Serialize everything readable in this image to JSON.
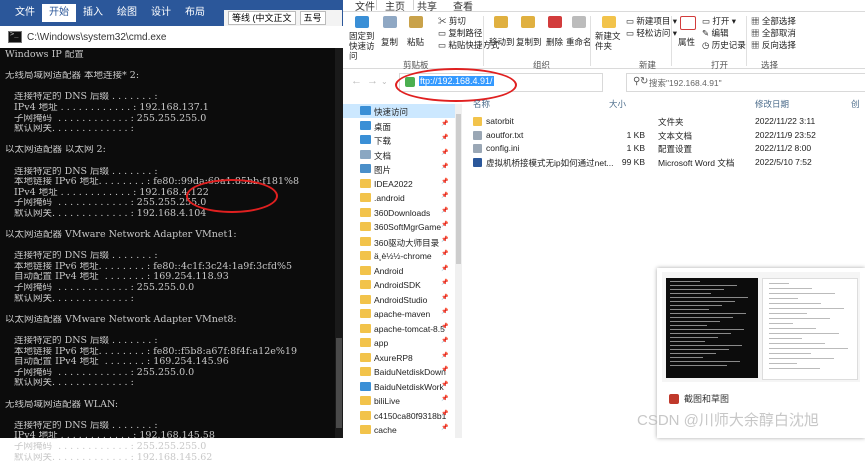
{
  "word": {
    "tabs": [
      "文件",
      "开始",
      "插入",
      "绘图",
      "设计",
      "布局"
    ],
    "font_name": "等线 (中文正文",
    "font_size": "五号"
  },
  "cmd": {
    "title": "C:\\Windows\\system32\\cmd.exe",
    "lines": [
      "Windows IP 配置",
      "",
      "无线局域网适配器 本地连接* 2:",
      "",
      "   连接特定的 DNS 后缀 . . . . . . . :",
      "   IPv4 地址 . . . . . . . . . . . . : 192.168.137.1",
      "   子网掩码  . . . . . . . . . . . . : 255.255.255.0",
      "   默认网关. . . . . . . . . . . . . :",
      "",
      "以太网适配器 以太网 2:",
      "",
      "   连接特定的 DNS 后缀 . . . . . . . :",
      "   本地链接 IPv6 地址. . . . . . . . : fe80::99da:69a1:85bb:f181%8",
      "   IPv4 地址 . . . . . . . . . . . . : 192.168.4.122",
      "   子网掩码  . . . . . . . . . . . . : 255.255.255.0",
      "   默认网关. . . . . . . . . . . . . : 192.168.4.104",
      "",
      "以太网适配器 VMware Network Adapter VMnet1:",
      "",
      "   连接特定的 DNS 后缀 . . . . . . . :",
      "   本地链接 IPv6 地址. . . . . . . . : fe80::4c1f:3c24:1a9f:3cfd%5",
      "   自动配置 IPv4 地址  . . . . . . . : 169.254.118.93",
      "   子网掩码  . . . . . . . . . . . . : 255.255.0.0",
      "   默认网关. . . . . . . . . . . . . :",
      "",
      "以太网适配器 VMware Network Adapter VMnet8:",
      "",
      "   连接特定的 DNS 后缀 . . . . . . . :",
      "   本地链接 IPv6 地址. . . . . . . . : fe80::f5b8:a67f:8f4f:a12e%19",
      "   自动配置 IPv4 地址  . . . . . . . : 169.254.145.96",
      "   子网掩码  . . . . . . . . . . . . : 255.255.0.0",
      "   默认网关. . . . . . . . . . . . . :",
      "",
      "无线局域网适配器 WLAN:",
      "",
      "   连接特定的 DNS 后缀 . . . . . . . :",
      "   IPv4 地址 . . . . . . . . . . . . : 192.168.145.58",
      "   子网掩码  . . . . . . . . . . . . : 255.255.255.0",
      "   默认网关. . . . . . . . . . . . . : 192.168.145.62"
    ]
  },
  "explorer": {
    "ribbon_tabs": [
      "文件",
      "主页",
      "共享",
      "查看"
    ],
    "ribbon": {
      "pin": "固定到快速访问",
      "copy": "复制",
      "paste": "粘贴",
      "cut": "剪切",
      "copy_path": "复制路径",
      "paste_shortcut": "粘贴快捷方式",
      "move_to": "移动到",
      "copy_to": "复制到",
      "delete": "删除",
      "rename": "重命名",
      "new_folder": "新建文件夹",
      "new_item": "新建项目",
      "easy_access": "轻松访问",
      "properties": "属性",
      "open": "打开",
      "edit": "编辑",
      "history": "历史记录",
      "select_all": "全部选择",
      "select_none": "全部取消",
      "invert": "反向选择",
      "groups": [
        "剪贴板",
        "组织",
        "新建",
        "打开",
        "选择"
      ]
    },
    "address": "ftp://192.168.4.91/",
    "search_placeholder": "搜索\"192.168.4.91\"",
    "columns": [
      "名称",
      "大小",
      "修改日期",
      "类型"
    ],
    "columns_extra": "创",
    "nav": [
      {
        "label": "快速访问",
        "icon": "star-icon",
        "color": "#3a8fd6",
        "selected": true,
        "pin": false
      },
      {
        "label": "桌面",
        "icon": "desktop-icon",
        "color": "#3a8fd6",
        "pin": true
      },
      {
        "label": "下载",
        "icon": "download-icon",
        "color": "#3a8fd6",
        "pin": true
      },
      {
        "label": "文档",
        "icon": "document-icon",
        "color": "#8aa7c2",
        "pin": true
      },
      {
        "label": "图片",
        "icon": "picture-icon",
        "color": "#4a8fc9",
        "pin": true
      },
      {
        "label": "IDEA2022",
        "icon": "folder-icon",
        "color": "#f2c34b",
        "pin": true
      },
      {
        "label": ".android",
        "icon": "folder-icon",
        "color": "#f2c34b",
        "pin": true
      },
      {
        "label": "360Downloads",
        "icon": "folder-icon",
        "color": "#f2c34b",
        "pin": true
      },
      {
        "label": "360SoftMgrGame",
        "icon": "folder-icon",
        "color": "#f2c34b",
        "pin": true
      },
      {
        "label": "360驱动大师目录",
        "icon": "folder-icon",
        "color": "#f2c34b",
        "pin": true
      },
      {
        "label": "ä¸è½½-chrome",
        "icon": "folder-icon",
        "color": "#f2c34b",
        "pin": true
      },
      {
        "label": "Android",
        "icon": "folder-icon",
        "color": "#f2c34b",
        "pin": true
      },
      {
        "label": "AndroidSDK",
        "icon": "folder-icon",
        "color": "#f2c34b",
        "pin": true
      },
      {
        "label": "AndroidStudio",
        "icon": "folder-icon",
        "color": "#f2c34b",
        "pin": true
      },
      {
        "label": "apache-maven",
        "icon": "folder-icon",
        "color": "#f2c34b",
        "pin": true
      },
      {
        "label": "apache-tomcat-8.5",
        "icon": "folder-icon",
        "color": "#f2c34b",
        "pin": true
      },
      {
        "label": "app",
        "icon": "folder-icon",
        "color": "#f2c34b",
        "pin": true
      },
      {
        "label": "AxureRP8",
        "icon": "folder-icon",
        "color": "#f2c34b",
        "pin": true
      },
      {
        "label": "BaiduNetdiskDown",
        "icon": "folder-icon",
        "color": "#f2c34b",
        "pin": true
      },
      {
        "label": "BaiduNetdiskWork",
        "icon": "folder-icon",
        "color": "#3a8fd6",
        "pin": true
      },
      {
        "label": "biliLive",
        "icon": "folder-icon",
        "color": "#f2c34b",
        "pin": true
      },
      {
        "label": "c4150ca80f9318b1",
        "icon": "folder-icon",
        "color": "#f2c34b",
        "pin": true
      },
      {
        "label": "cache",
        "icon": "folder-icon",
        "color": "#f2c34b",
        "pin": true
      }
    ],
    "files": [
      {
        "name": "satorbit",
        "size": "",
        "date": "2022/11/22 3:11",
        "type": "文件夹",
        "icon": "folder-icon",
        "color": "#f2c34b"
      },
      {
        "name": "aoutfor.txt",
        "size": "1 KB",
        "date": "2022/11/9 23:52",
        "type": "文本文档",
        "icon": "text-file-icon",
        "color": "#9aa7b5"
      },
      {
        "name": "config.ini",
        "size": "1 KB",
        "date": "2022/11/2 8:00",
        "type": "配置设置",
        "icon": "config-file-icon",
        "color": "#9aa7b5"
      },
      {
        "name": "虚拟机桥接模式无ip如何通过net...",
        "size": "99 KB",
        "date": "2022/5/10 7:52",
        "type": "Microsoft Word 文档",
        "icon": "word-file-icon",
        "color": "#2b579a"
      }
    ]
  },
  "popup": {
    "title": "截图和草图"
  },
  "watermark": "CSDN @川师大余醇白沈旭",
  "colors": {
    "word_blue": "#2b579a",
    "annotation_red": "#e02020",
    "selection_blue": "#cce8ff"
  }
}
